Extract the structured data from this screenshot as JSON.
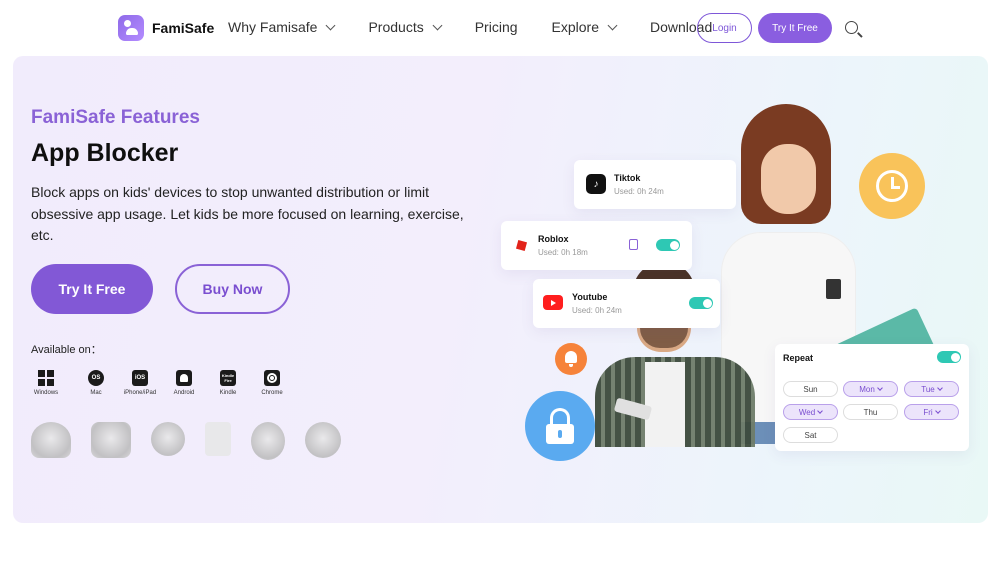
{
  "nav": {
    "brand": "FamiSafe",
    "links": [
      {
        "label": "Why Famisafe",
        "has_dropdown": true
      },
      {
        "label": "Products",
        "has_dropdown": true
      },
      {
        "label": "Pricing",
        "has_dropdown": false
      },
      {
        "label": "Explore",
        "has_dropdown": true
      },
      {
        "label": "Download",
        "has_dropdown": false
      }
    ],
    "login_label": "Login",
    "try_label": "Try It Free",
    "search_icon": "search-icon"
  },
  "hero": {
    "eyebrow": "FamiSafe Features",
    "title": "App Blocker",
    "description": "Block apps on kids' devices to stop unwanted distribution or limit obsessive app usage. Let kids be more focused on learning, exercise, etc.",
    "try_label": "Try It Free",
    "buy_label": "Buy Now",
    "available_label": "Available on：",
    "platforms": [
      {
        "label": "Windows",
        "icon": "windows-icon"
      },
      {
        "label": "Mac",
        "icon": "mac-icon"
      },
      {
        "label": "iPhone/iPad",
        "icon": "ios-icon"
      },
      {
        "label": "Android",
        "icon": "android-icon"
      },
      {
        "label": "Kindle",
        "icon": "kindle-icon"
      },
      {
        "label": "Chrome",
        "icon": "chrome-icon"
      }
    ],
    "platform_icon_text": {
      "mac": "OS",
      "ios": "iOS",
      "kindle": "Kindle Fire"
    }
  },
  "illustration": {
    "apps": [
      {
        "name": "Tiktok",
        "usage": "Used: 0h 24m"
      },
      {
        "name": "Roblox",
        "usage": "Used: 0h 18m"
      },
      {
        "name": "Youtube",
        "usage": "Used: 0h 24m"
      }
    ],
    "repeat": {
      "label": "Repeat",
      "days": [
        {
          "label": "Sun",
          "selected": false
        },
        {
          "label": "Mon",
          "selected": true
        },
        {
          "label": "Tue",
          "selected": true
        },
        {
          "label": "Wed",
          "selected": true
        },
        {
          "label": "Thu",
          "selected": false
        },
        {
          "label": "Fri",
          "selected": true
        },
        {
          "label": "Sat",
          "selected": false
        }
      ]
    }
  },
  "colors": {
    "accent": "#8258d6",
    "toggle_on": "#2ec8b4",
    "clock_badge": "#f9c35a",
    "lock_badge": "#5aaaf0",
    "bell_badge": "#f6833a"
  }
}
